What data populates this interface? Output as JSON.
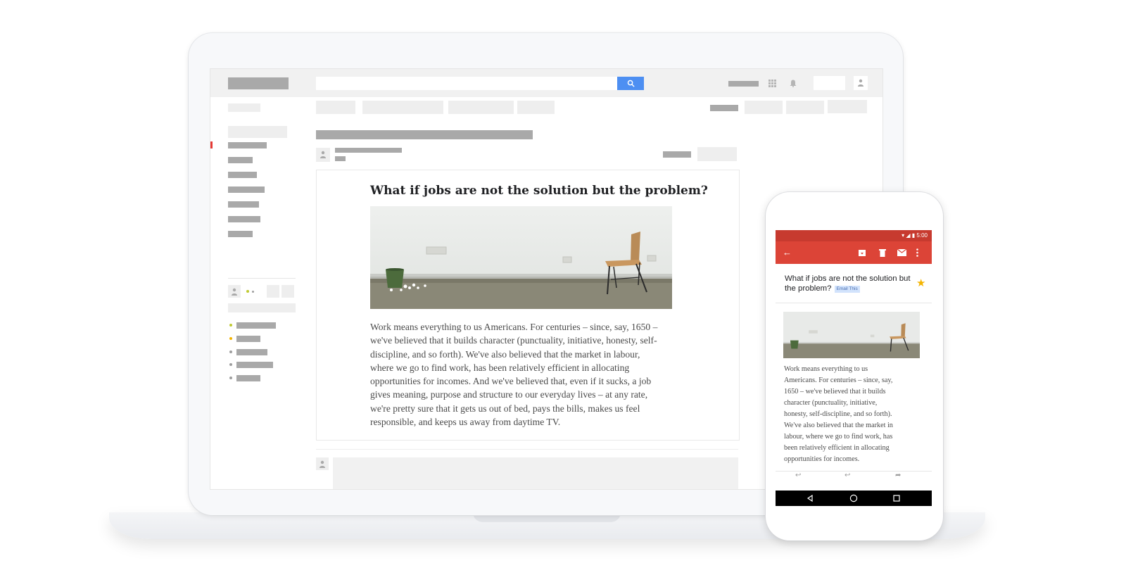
{
  "email": {
    "title": "What if jobs are not the solution but the problem?",
    "body": "Work means everything to us Americans. For centuries – since, say, 1650 –\nwe've believed that it builds character (punctuality, initiative, honesty, self-\ndiscipline, and so forth). We've also believed that the market in labour,\nwhere we go to find work, has been relatively efficient in allocating\nopportunities for incomes. And we've believed that, even if it sucks, a job\ngives meaning, purpose and structure to our everyday lives – at any rate,\nwe're pretty sure that it gets us out of bed, pays the bills, makes us feel\nresponsible, and keeps us away from daytime TV."
  },
  "phone": {
    "time": "5:00",
    "subject": "What if jobs are not the solution but the problem?",
    "badge": "Email This",
    "body": "Work means everything to us\nAmericans. For centuries – since, say,\n1650 – we've believed that it builds\ncharacter (punctuality, initiative,\nhonesty, self-discipline, and so forth).\nWe've also believed that the market in\nlabour, where we go to find work, has\nbeen relatively efficient in allocating\nopportunities for incomes."
  },
  "colors": {
    "search_button": "#4d8ff2",
    "app_bar": "#dc4437",
    "status_bar": "#c73a2f",
    "star": "#f4b400",
    "active_indicator": "#e53935",
    "online_dot": "#c0ca33"
  },
  "icons": [
    "search-icon",
    "apps-grid-icon",
    "bell-icon",
    "avatar-icon",
    "back-arrow-icon",
    "archive-icon",
    "delete-icon",
    "mail-icon",
    "more-vert-icon",
    "star-icon",
    "reply-icon",
    "reply-all-icon",
    "forward-icon",
    "nav-back-icon",
    "nav-home-icon",
    "nav-recents-icon"
  ]
}
